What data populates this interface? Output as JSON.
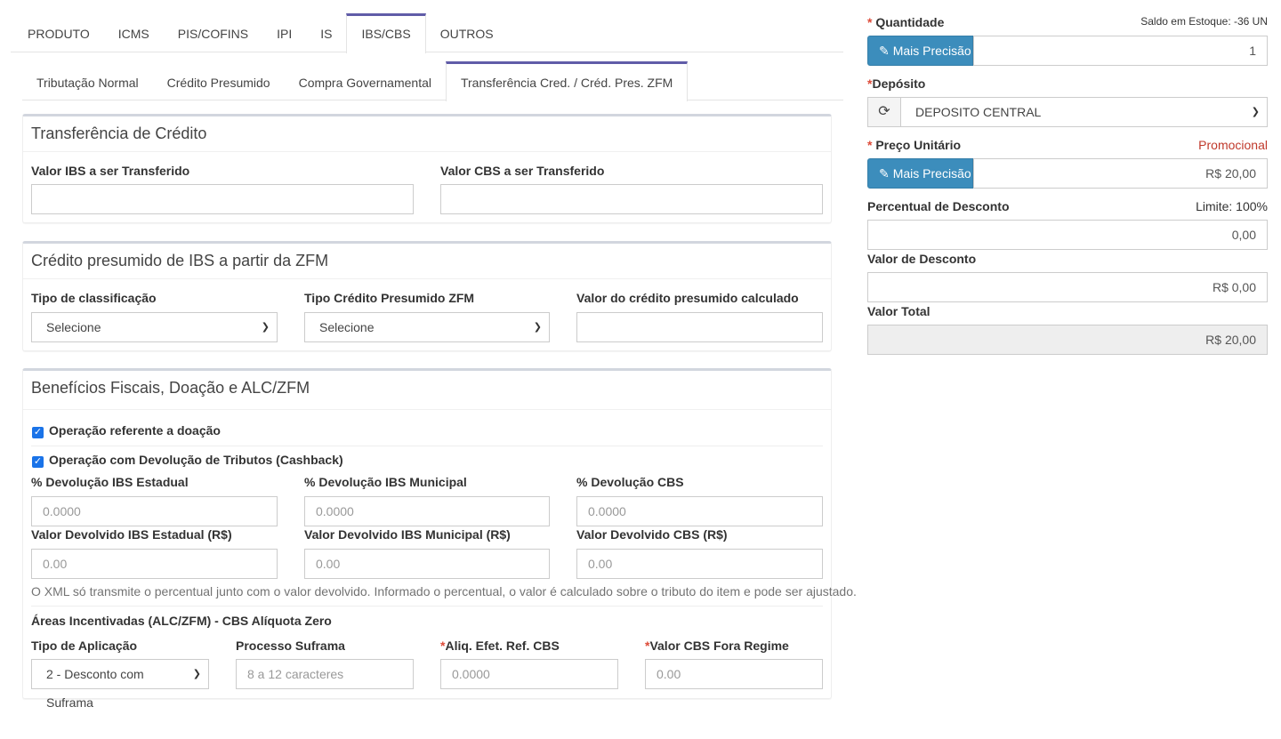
{
  "main_tabs": [
    {
      "label": "PRODUTO"
    },
    {
      "label": "ICMS"
    },
    {
      "label": "PIS/COFINS"
    },
    {
      "label": "IPI"
    },
    {
      "label": "IS"
    },
    {
      "label": "IBS/CBS"
    },
    {
      "label": "OUTROS"
    }
  ],
  "sub_tabs": [
    {
      "label": "Tributação Normal"
    },
    {
      "label": "Crédito Presumido"
    },
    {
      "label": "Compra Governamental"
    },
    {
      "label": "Transferência Cred. / Créd. Pres. ZFM"
    }
  ],
  "transferencia": {
    "title": "Transferência de Crédito",
    "ibs_label": "Valor IBS a ser Transferido",
    "ibs_value": "",
    "cbs_label": "Valor CBS a ser Transferido",
    "cbs_value": ""
  },
  "zfm": {
    "title": "Crédito presumido de IBS a partir da ZFM",
    "tipo_class_label": "Tipo de classificação",
    "tipo_class_value": "Selecione",
    "tipo_cred_label": "Tipo Crédito Presumido ZFM",
    "tipo_cred_value": "Selecione",
    "valor_calc_label": "Valor do crédito presumido calculado",
    "valor_calc_value": ""
  },
  "beneficios": {
    "title": "Benefícios Fiscais, Doação e ALC/ZFM",
    "doacao_label": "Operação referente a doação",
    "cashback_label": "Operação com Devolução de Tributos (Cashback)",
    "dev_ibs_est_label": "% Devolução IBS Estadual",
    "dev_ibs_est_ph": "0.0000",
    "dev_ibs_mun_label": "% Devolução IBS Municipal",
    "dev_ibs_mun_ph": "0.0000",
    "dev_cbs_label": "% Devolução CBS",
    "dev_cbs_ph": "0.0000",
    "val_ibs_est_label": "Valor Devolvido IBS Estadual (R$)",
    "val_ibs_est_ph": "0.00",
    "val_ibs_mun_label": "Valor Devolvido IBS Municipal (R$)",
    "val_ibs_mun_ph": "0.00",
    "val_cbs_label": "Valor Devolvido CBS (R$)",
    "val_cbs_ph": "0.00",
    "help_text": "O XML só transmite o percentual junto com o valor devolvido. Informado o percentual, o valor é calculado sobre o tributo do item e pode ser ajustado.",
    "areas_label": "Áreas Incentivadas (ALC/ZFM) - CBS Alíquota Zero",
    "tipo_aplic_label": "Tipo de Aplicação",
    "tipo_aplic_value": "2 - Desconto com Suframa",
    "processo_label": "Processo Suframa",
    "processo_ph": "8 a 12 caracteres",
    "aliq_label": "Aliq. Efet. Ref. CBS",
    "aliq_ph": "0.0000",
    "valor_cbs_label": "Valor CBS Fora Regime",
    "valor_cbs_ph": "0.00"
  },
  "side": {
    "quantidade_label": "Quantidade",
    "saldo_text": "Saldo em Estoque: -36 UN",
    "mais_precisao": "Mais Precisão",
    "quantidade_value": "1",
    "deposito_label": "Depósito",
    "deposito_value": "DEPOSITO CENTRAL",
    "preco_label": "Preço Unitário",
    "promocional": "Promocional",
    "preco_value": "R$ 20,00",
    "perc_desc_label": "Percentual de Desconto",
    "limite_text": "Limite: 100%",
    "perc_desc_value": "0,00",
    "valor_desc_label": "Valor de Desconto",
    "valor_desc_value": "R$ 0,00",
    "valor_total_label": "Valor Total",
    "valor_total_value": "R$ 20,00",
    "asterisk": "*"
  },
  "colors": {
    "accent": "#605ca8",
    "button": "#3c8dbc",
    "required": "#dd4b39",
    "promo": "#c0392b"
  }
}
